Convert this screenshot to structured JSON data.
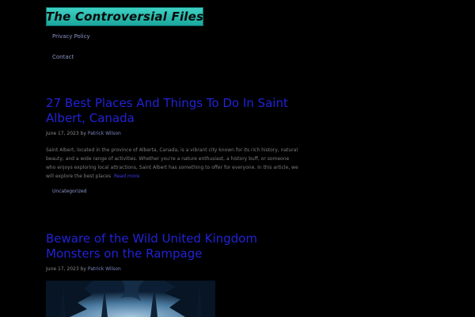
{
  "site": {
    "logo_text": "The Controversial Files",
    "colors": {
      "background": "#000000",
      "logo_bg": "#2bbfb3",
      "link": "#2222d6",
      "meta_text": "#8b8b8b"
    }
  },
  "nav": {
    "items": [
      {
        "label": "Privacy Policy"
      },
      {
        "label": "Contact"
      }
    ]
  },
  "posts": [
    {
      "title": "27 Best Places And Things To Do In Saint Albert, Canada",
      "date": "June 17, 2023",
      "by": "by",
      "author": "Patrick Wilson",
      "excerpt": "Saint Albert, located in the province of Alberta, Canada, is a vibrant city known for its rich history, natural beauty, and a wide range of activities. Whether you're a nature enthusiast, a history buff, or someone who enjoys exploring local attractions, Saint Albert has something to offer for everyone. In this article, we will explore the best places",
      "read_more": "Read more",
      "category": "Uncategorized"
    },
    {
      "title": "Beware of the Wild United Kingdom Monsters on the Rampage",
      "date": "June 17, 2023",
      "by": "by",
      "author": "Patrick Wilson",
      "image_icon": "forest-image"
    }
  ]
}
